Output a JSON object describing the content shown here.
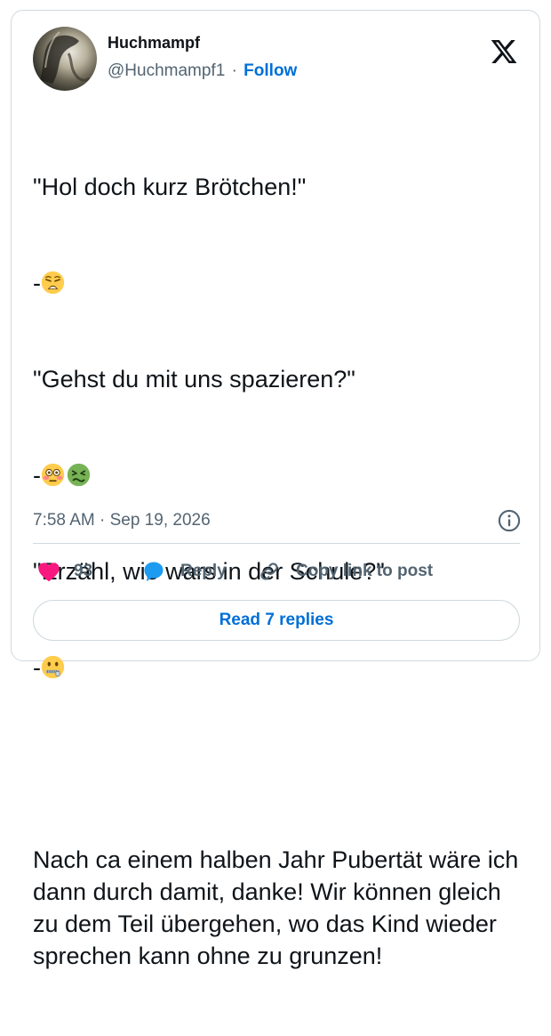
{
  "author": {
    "display_name": "Huchmampf",
    "handle": "@Huchmampf1",
    "separator": "·",
    "follow_label": "Follow"
  },
  "tweet": {
    "lines": [
      "\"Hol doch kurz Brötchen!\"",
      "-",
      "\"Gehst du mit uns spazieren?\"",
      "-",
      "\"Erzähl, wie wars in der Schule?\"",
      "-"
    ],
    "emoji": [
      "weary-face",
      "flushed-face",
      "nauseated-face",
      "zipper-mouth-face"
    ],
    "paragraph": "Nach ca einem halben Jahr Pubertät wäre ich dann durch damit, danke! Wir können gleich zu dem Teil übergehen, wo das Kind wieder sprechen kann ohne zu grunzen!"
  },
  "meta": {
    "time": "7:58 AM",
    "separator": "·",
    "date": "Sep 19, 2026"
  },
  "actions": {
    "like_count": "93",
    "reply_label": "Reply",
    "copy_label": "Copy link to post"
  },
  "read_replies_label": "Read 7 replies",
  "colors": {
    "accent": "#006fd6",
    "like": "#f91880",
    "reply": "#1d9bf0",
    "text": "#0f1419",
    "muted": "#536471",
    "border": "#cfd9de"
  }
}
